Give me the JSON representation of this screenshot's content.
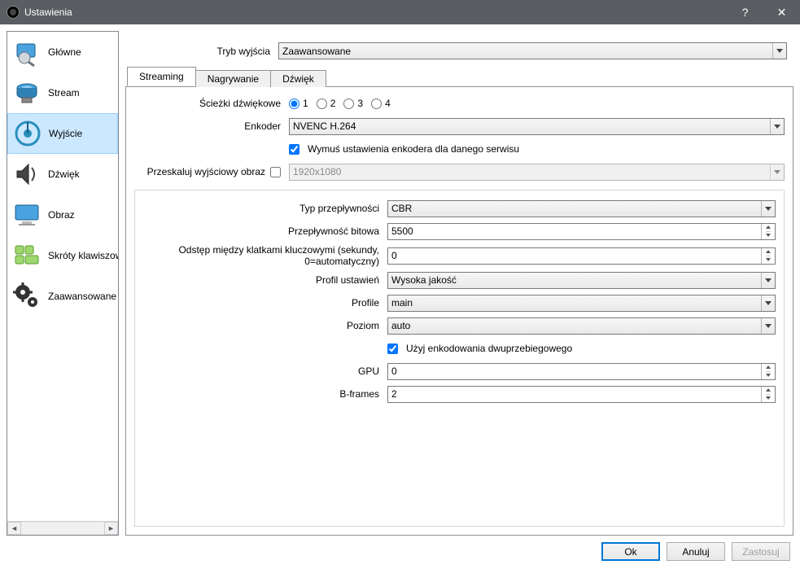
{
  "titlebar": {
    "title": "Ustawienia"
  },
  "sidebar": {
    "items": [
      {
        "label": "Główne"
      },
      {
        "label": "Stream"
      },
      {
        "label": "Wyjście"
      },
      {
        "label": "Dźwięk"
      },
      {
        "label": "Obraz"
      },
      {
        "label": "Skróty klawiszowe"
      },
      {
        "label": "Zaawansowane"
      }
    ]
  },
  "top": {
    "mode_label": "Tryb wyjścia",
    "mode_value": "Zaawansowane"
  },
  "tabs": {
    "streaming": "Streaming",
    "recording": "Nagrywanie",
    "audio": "Dźwięk"
  },
  "form": {
    "tracks_label": "Ścieżki dźwiękowe",
    "track_opts": [
      "1",
      "2",
      "3",
      "4"
    ],
    "encoder_label": "Enkoder",
    "encoder_value": "NVENC H.264",
    "enforce_label": "Wymuś ustawienia enkodera dla danego serwisu",
    "rescale_label": "Przeskaluj wyjściowy obraz",
    "rescale_value": "1920x1080"
  },
  "enc": {
    "rate_control_label": "Typ przepływności",
    "rate_control_value": "CBR",
    "bitrate_label": "Przepływność bitowa",
    "bitrate_value": "5500",
    "keyint_label": "Odstęp między klatkami kluczowymi (sekundy, 0=automatyczny)",
    "keyint_value": "0",
    "preset_label": "Profil ustawień",
    "preset_value": "Wysoka jakość",
    "profile_label": "Profile",
    "profile_value": "main",
    "level_label": "Poziom",
    "level_value": "auto",
    "twopass_label": "Użyj enkodowania dwuprzebiegowego",
    "gpu_label": "GPU",
    "gpu_value": "0",
    "bframes_label": "B-frames",
    "bframes_value": "2"
  },
  "footer": {
    "ok": "Ok",
    "cancel": "Anuluj",
    "apply": "Zastosuj"
  }
}
